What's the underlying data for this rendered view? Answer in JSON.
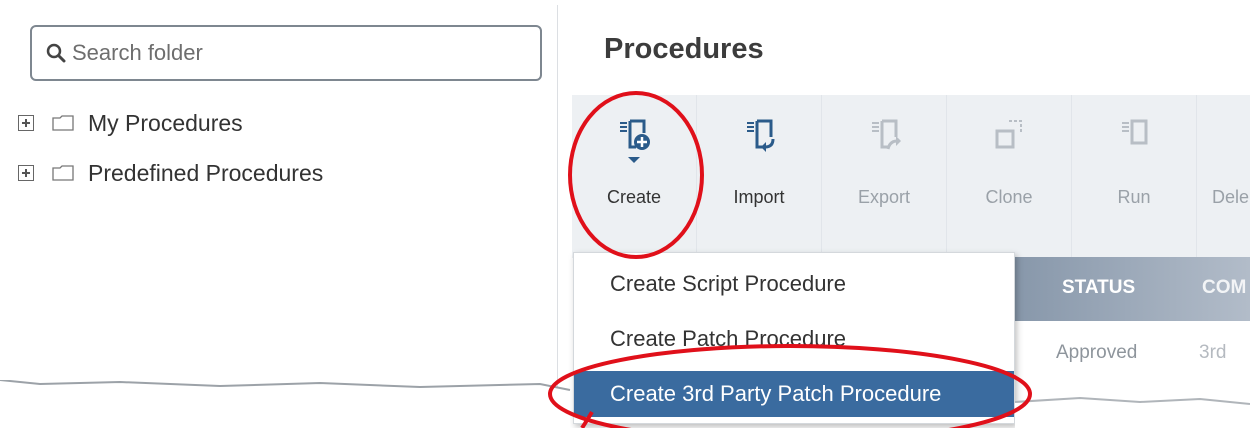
{
  "sidebar": {
    "search_placeholder": "Search folder",
    "tree": [
      {
        "label": "My Procedures"
      },
      {
        "label": "Predefined Procedures"
      }
    ]
  },
  "main": {
    "title": "Procedures",
    "toolbar": [
      {
        "label": "Create",
        "icon": "create-procedure-icon",
        "enabled": true
      },
      {
        "label": "Import",
        "icon": "import-icon",
        "enabled": true
      },
      {
        "label": "Export",
        "icon": "export-icon",
        "enabled": false
      },
      {
        "label": "Clone",
        "icon": "clone-icon",
        "enabled": false
      },
      {
        "label": "Run",
        "icon": "run-icon",
        "enabled": false
      },
      {
        "label": "Dele",
        "icon": "delete-icon",
        "enabled": false
      }
    ],
    "table": {
      "columns": [
        "STATUS",
        "COM"
      ],
      "rows": [
        {
          "status": "Approved",
          "comp": "3rd"
        }
      ]
    },
    "create_menu": [
      {
        "label": "Create Script Procedure"
      },
      {
        "label": "Create Patch Procedure"
      },
      {
        "label": "Create 3rd Party Patch Procedure"
      }
    ]
  },
  "colors": {
    "annotation": "#e0101a",
    "menu_highlight": "#3a6b9f",
    "icon_blue": "#2b5b8a"
  }
}
